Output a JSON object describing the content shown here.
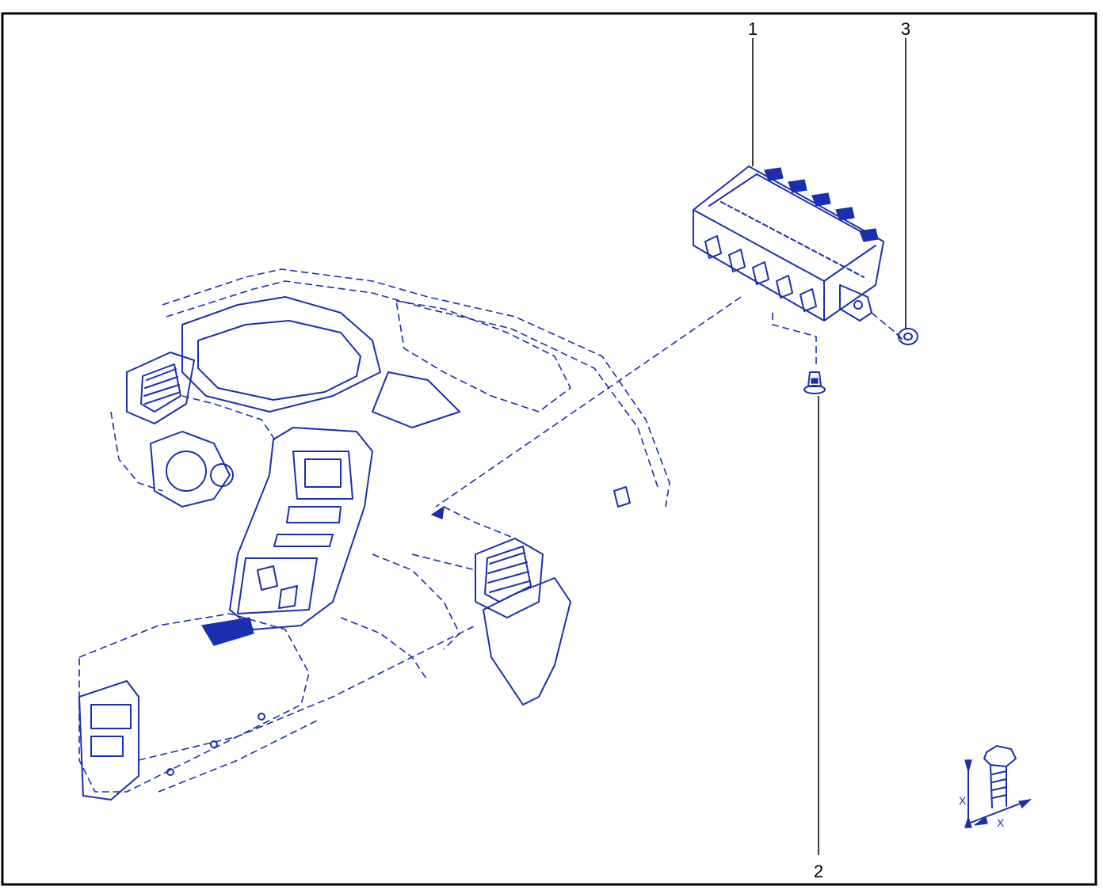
{
  "callouts": {
    "part_1": "1",
    "part_2": "2",
    "part_3": "3"
  },
  "torque_symbol": {
    "height_label": "X",
    "width_label": "X"
  },
  "colors": {
    "line_art": "#1a2fb0",
    "frame": "#000000",
    "background": "#ffffff"
  }
}
